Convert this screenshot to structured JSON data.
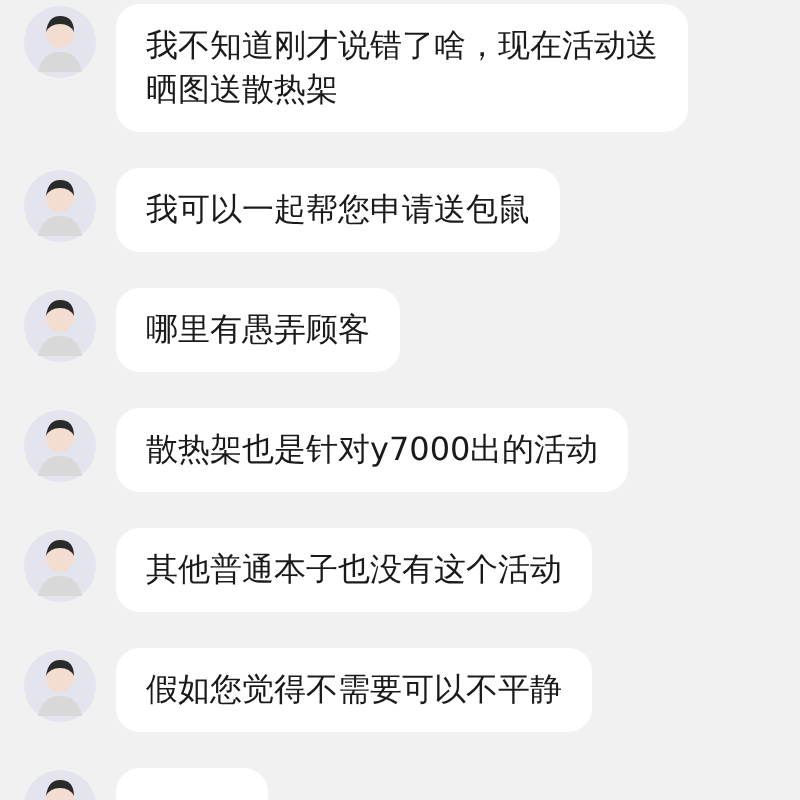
{
  "messages": [
    {
      "text": "我不知道刚才说错了啥，现在活动送晒图送散热架"
    },
    {
      "text": "我可以一起帮您申请送包鼠"
    },
    {
      "text": "哪里有愚弄顾客"
    },
    {
      "text": "散热架也是针对y7000出的活动"
    },
    {
      "text": "其他普通本子也没有这个活动"
    },
    {
      "text": "假如您觉得不需要可以不平静"
    },
    {
      "kind": "cut-off"
    }
  ]
}
